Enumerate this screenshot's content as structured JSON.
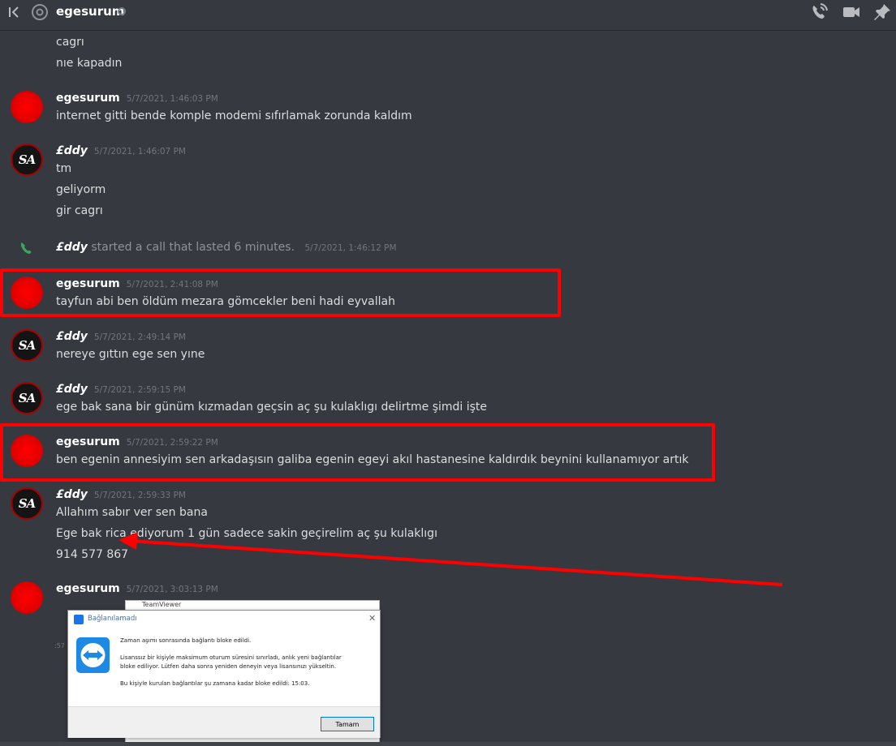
{
  "header": {
    "title": "egesurum"
  },
  "messages": {
    "pre1": "cagrı",
    "pre2": "nıe kapadın",
    "m1": {
      "author": "egesurum",
      "time": "5/7/2021, 1:46:03 PM",
      "lines": [
        "internet gitti bende komple modemi sıfırlamak zorunda kaldım"
      ]
    },
    "m2": {
      "author": "£ddy",
      "time": "5/7/2021, 1:46:07 PM",
      "lines": [
        "tm",
        "geliyorm",
        "gir cagrı"
      ]
    },
    "call": {
      "who": "£ddy",
      "text": "started a call that lasted 6 minutes.",
      "time": "5/7/2021, 1:46:12 PM"
    },
    "m3": {
      "author": "egesurum",
      "time": "5/7/2021, 2:41:08 PM",
      "lines": [
        "tayfun abi ben öldüm mezara gömcekler beni hadi eyvallah"
      ]
    },
    "m4": {
      "author": "£ddy",
      "time": "5/7/2021, 2:49:14 PM",
      "lines": [
        "nereye gıttın ege sen yıne"
      ]
    },
    "m5": {
      "author": "£ddy",
      "time": "5/7/2021, 2:59:15 PM",
      "lines": [
        "ege bak sana bir günüm kızmadan geçsin aç şu kulaklıgı delirtme şimdi işte"
      ]
    },
    "m6": {
      "author": "egesurum",
      "time": "5/7/2021, 2:59:22 PM",
      "lines": [
        "ben egenin annesiyim sen arkadaşısın galiba egenin egeyi akıl hastanesine kaldırdık beynini kullanamıyor artık"
      ]
    },
    "m7": {
      "author": "£ddy",
      "time": "5/7/2021, 2:59:33 PM",
      "lines": [
        "Allahım sabır ver sen bana",
        "Ege bak rica ediyorum 1 gün sadece sakin geçirelim aç şu kulaklıgı",
        "914 577 867"
      ]
    },
    "m8": {
      "author": "egesurum",
      "time": "5/7/2021, 3:03:13 PM"
    },
    "avatar_sa": "SA",
    "stray": ":57"
  },
  "dialog": {
    "back_title": "TeamViewer",
    "title": "Bağlanılamadı",
    "close": "✕",
    "line1": "Zaman aşımı sonrasında bağlantı bloke edildi.",
    "line2": "Lisanssız bir kişiyle maksimum oturum süresini sınırladı, anlık yeni bağlantılar",
    "line3": "bloke ediliyor. Lütfen daha sonra yeniden deneyin veya lisansınızı yükseltin.",
    "line4": "Bu kişiyle kurulan bağlantılar şu zamana kadar bloke edildi: 15:03.",
    "ok": "Tamam"
  },
  "colors": {
    "highlight": "#ff0000",
    "background": "#36393f",
    "call_icon": "#3ba55c"
  }
}
